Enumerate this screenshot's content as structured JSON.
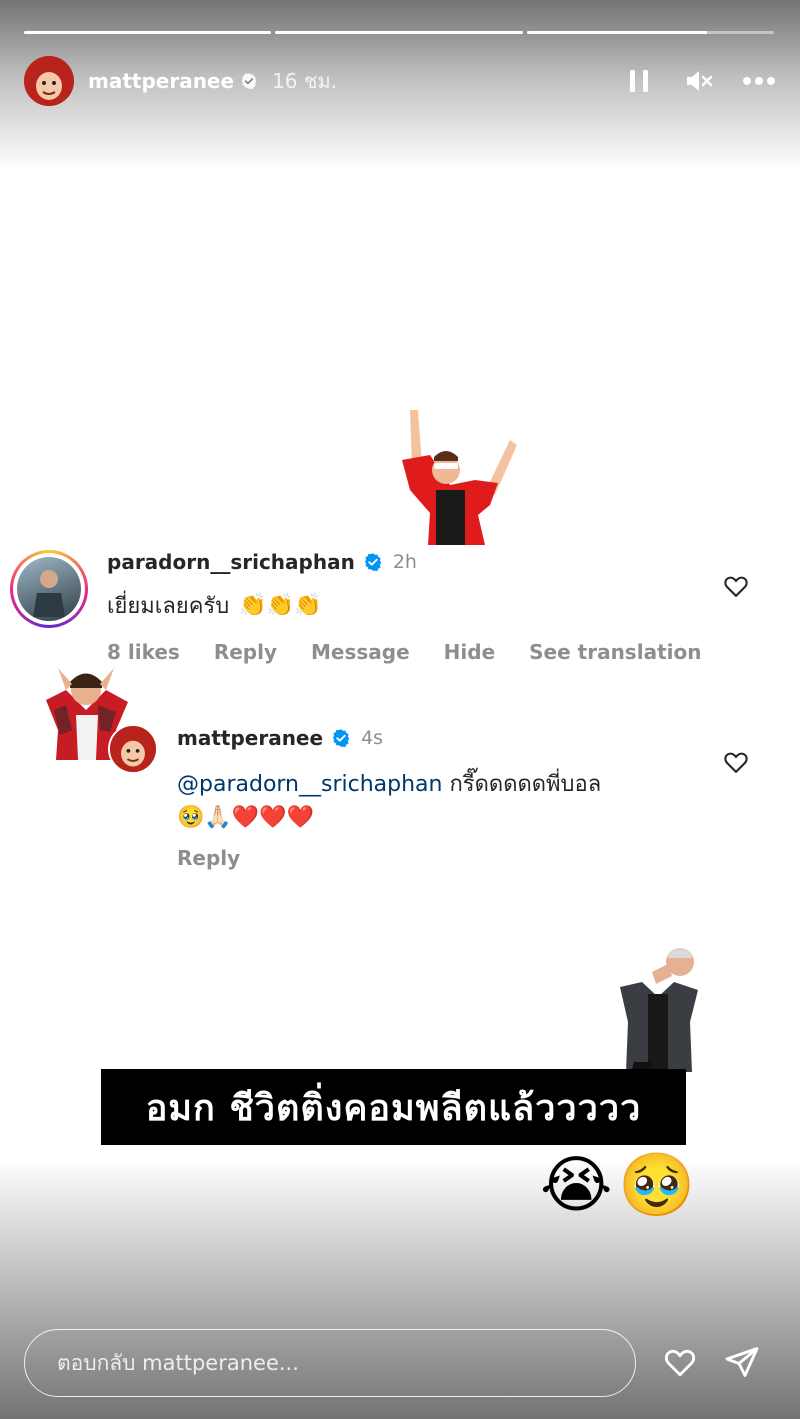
{
  "story": {
    "progress": [
      1.0,
      1.0,
      0.73
    ],
    "username": "mattperanee",
    "time": "16 ชม.",
    "icons": {
      "pause": "pause-icon",
      "mute": "mute-icon",
      "more": "more-icon",
      "verified": "verified-badge-icon"
    }
  },
  "comments": [
    {
      "username": "paradorn__srichaphan",
      "time": "2h",
      "text": "เยี่ยมเลยครับ",
      "emoji": "👏👏👏",
      "likes": "8 likes",
      "reply": "Reply",
      "message": "Message",
      "hide": "Hide",
      "translate": "See translation"
    },
    {
      "username": "mattperanee",
      "time": "4s",
      "mention": "@paradorn__srichaphan",
      "text": "กรี๊ดดดดดพี่บอล",
      "emoji": "🥹🙏🏻❤️❤️❤️",
      "reply": "Reply"
    }
  ],
  "caption": "อมก  ชีวิตติ่งคอมพลีตแล้ววววว",
  "caption_emoji": [
    "😭",
    "🥹"
  ],
  "reply_bar": {
    "placeholder": "ตอบกลับ mattperanee..."
  },
  "colors": {
    "accent_blue": "#0095f6",
    "mention": "#00376b",
    "text": "#262626",
    "muted": "#8e8e8e"
  }
}
